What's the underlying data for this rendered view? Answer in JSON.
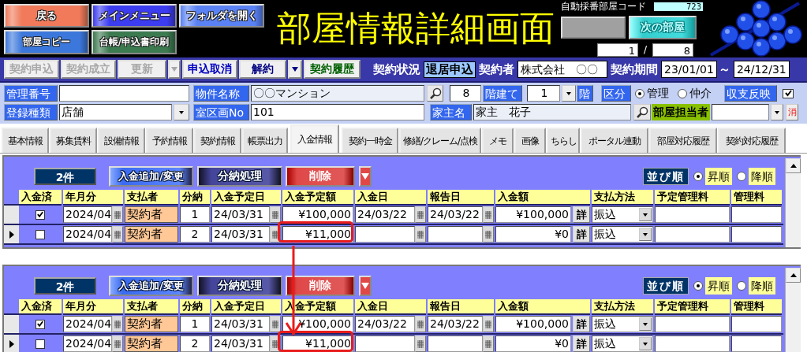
{
  "header": {
    "buttons": [
      {
        "label": "戻る",
        "color": "#f07a5a"
      },
      {
        "label": "メインメニュー",
        "color": "#3c3cf0"
      },
      {
        "label": "フォルダを開く",
        "color": "#5a82f5"
      },
      {
        "label": "部屋コピー",
        "color": "#3c78dc"
      },
      {
        "label": "台帳/申込書印刷",
        "color": "#3c7a50"
      }
    ],
    "title": "部屋情報詳細画面",
    "room_code": {
      "label": "自動採番部屋コード",
      "value": "723"
    },
    "next_button": "次の部屋",
    "position": {
      "current": "1",
      "separator": "/",
      "total": "8"
    }
  },
  "toolbar": {
    "buttons": [
      {
        "kind": "button",
        "label": "契約申込",
        "disabled": true
      },
      {
        "kind": "button",
        "label": "契約成立",
        "disabled": true
      },
      {
        "kind": "button",
        "label": "更新",
        "disabled": true
      },
      {
        "kind": "dropdown",
        "disabled": true
      },
      {
        "kind": "button",
        "label": "申込取消",
        "disabled": false,
        "color": "#0000c0"
      },
      {
        "kind": "button",
        "label": "解約",
        "disabled": false,
        "color": "#000080"
      },
      {
        "kind": "dropdown",
        "disabled": false,
        "color": "#000080"
      },
      {
        "kind": "button",
        "label": "契約履歴",
        "disabled": false,
        "color": "#006000"
      }
    ],
    "contract": {
      "status_label": "契約状況",
      "status": "退居申込",
      "contractor_label": "契約者",
      "contractor": "株式会社　〇〇",
      "period_label": "契約期間",
      "start": "23/01/01",
      "tilde": "～",
      "end": "24/12/31"
    }
  },
  "property": {
    "upper_fields": [
      {
        "kind": "label",
        "text": "管理番号"
      },
      {
        "kind": "field"
      },
      {
        "kind": "label",
        "text": "物件名称"
      },
      {
        "kind": "field",
        "value": "〇〇マンション",
        "readonly": true
      },
      {
        "kind": "search"
      },
      {
        "kind": "numberfield",
        "value": "8"
      },
      {
        "kind": "label",
        "text": "階建て"
      },
      {
        "kind": "numberfield",
        "value": "1"
      },
      {
        "kind": "dropdown"
      },
      {
        "kind": "label",
        "text": "階"
      },
      {
        "kind": "label",
        "text": "区分"
      },
      {
        "kind": "radio",
        "text": "管理",
        "selected": true
      },
      {
        "kind": "radio",
        "text": "仲介",
        "selected": false
      },
      {
        "kind": "label",
        "text": "収支反映"
      },
      {
        "kind": "checkbox",
        "checked": true
      }
    ],
    "lower_fields": [
      {
        "kind": "label",
        "text": "登録種類"
      },
      {
        "kind": "field",
        "value": "店舗"
      },
      {
        "kind": "dropdown"
      },
      {
        "kind": "label",
        "text": "室区画No"
      },
      {
        "kind": "field",
        "value": "101"
      },
      {
        "kind": "label",
        "text": "家主名"
      },
      {
        "kind": "field",
        "value": "家主　花子",
        "readonly": true
      },
      {
        "kind": "search"
      },
      {
        "kind": "greenlabel",
        "text": "部屋担当者"
      },
      {
        "kind": "field"
      },
      {
        "kind": "dropdown"
      },
      {
        "kind": "clear",
        "text": "消"
      }
    ]
  },
  "tabs": [
    {
      "label": "基本情報",
      "selected": false
    },
    {
      "label": "募集賃料",
      "selected": false
    },
    {
      "label": "設備情報",
      "selected": false
    },
    {
      "label": "予約情報",
      "selected": false
    },
    {
      "label": "契約情報",
      "selected": false
    },
    {
      "label": "帳票出力",
      "selected": false
    },
    {
      "label": "入金情報",
      "selected": true
    },
    {
      "label": "契約一時金",
      "selected": false
    },
    {
      "label": "修繕/クレーム/点検",
      "selected": false
    },
    {
      "label": "メモ",
      "selected": false
    },
    {
      "label": "画像",
      "selected": false
    },
    {
      "label": "ちらし",
      "selected": false
    },
    {
      "label": "ポータル連動",
      "selected": false
    },
    {
      "label": "部屋対応履歴",
      "selected": false
    },
    {
      "label": "契約対応履歴",
      "selected": false
    }
  ],
  "panels": [
    {
      "count": "2件",
      "buttons": [
        {
          "label": "入金追加/変更",
          "kind": "add"
        },
        {
          "label": "分納処理",
          "kind": "split"
        },
        {
          "label": "削除",
          "kind": "delete"
        },
        {
          "kind": "menu"
        }
      ],
      "sort": {
        "label": "並び順",
        "options": [
          {
            "label": "昇順",
            "selected": true
          },
          {
            "label": "降順",
            "selected": false
          }
        ]
      },
      "columns": [
        "入金済",
        "年月分",
        "支払者",
        "分納",
        "入金予定日",
        "入金予定額",
        "入金日",
        "報告日",
        "入金額",
        "支払方法",
        "予定管理料",
        "管理料"
      ],
      "rows": [
        {
          "current": false,
          "paid": true,
          "month": "2024/04",
          "payer": "契約者",
          "installment": "1",
          "planned_date": "24/03/31",
          "planned_amount": "¥100,000",
          "paid_date": "24/03/22",
          "report_date": "24/03/22",
          "amount": "¥100,000",
          "detail": "詳",
          "method": "振込",
          "highlighted": false
        },
        {
          "current": true,
          "paid": false,
          "month": "2024/04",
          "payer": "契約者",
          "installment": "2",
          "planned_date": "24/03/31",
          "planned_amount": "¥11,000",
          "amount": "¥0",
          "detail": "詳",
          "method": "振込",
          "highlighted": true
        }
      ]
    },
    {
      "count": "2件",
      "buttons": [
        {
          "label": "入金追加/変更",
          "kind": "add"
        },
        {
          "label": "分納処理",
          "kind": "split"
        },
        {
          "label": "削除",
          "kind": "delete"
        },
        {
          "kind": "menu"
        }
      ],
      "sort": {
        "label": "並び順",
        "options": [
          {
            "label": "昇順",
            "selected": true
          },
          {
            "label": "降順",
            "selected": false
          }
        ]
      },
      "columns": [
        "入金済",
        "年月分",
        "支払者",
        "分納",
        "入金予定日",
        "入金予定額",
        "入金日",
        "報告日",
        "入金額",
        "支払方法",
        "予定管理料",
        "管理料"
      ],
      "rows": [
        {
          "current": false,
          "paid": true,
          "month": "2024/04",
          "payer": "契約者",
          "installment": "1",
          "planned_date": "24/03/31",
          "planned_amount": "¥100,000",
          "paid_date": "24/03/22",
          "report_date": "24/03/22",
          "amount": "¥100,000",
          "detail": "詳",
          "method": "振込",
          "highlighted": false
        },
        {
          "current": true,
          "paid": false,
          "month": "2024/04",
          "payer": "契約者",
          "installment": "2",
          "planned_date": "24/03/31",
          "planned_amount": "¥11,000",
          "amount": "¥0",
          "detail": "詳",
          "method": "振込",
          "highlighted": true
        }
      ]
    }
  ],
  "annotation": {
    "kind": "arrow"
  }
}
